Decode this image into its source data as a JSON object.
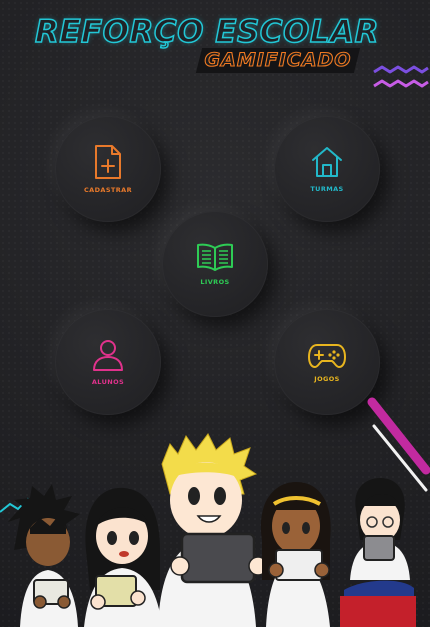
{
  "header": {
    "title": "REFORÇO ESCOLAR",
    "subtitle": "GAMIFICADO"
  },
  "colors": {
    "title_outline": "#22c7d6",
    "subtitle_outline": "#f07a22",
    "cadastrar": "#e8792b",
    "turmas": "#22b8c9",
    "livros": "#2ecc55",
    "alunos": "#e0328c",
    "jogos": "#e8b51f",
    "background": "#232326"
  },
  "menu": {
    "cadastrar": {
      "label": "CADASTRAR",
      "icon": "file-plus-icon"
    },
    "turmas": {
      "label": "TURMAS",
      "icon": "home-icon"
    },
    "livros": {
      "label": "LIVROS",
      "icon": "open-book-icon"
    },
    "alunos": {
      "label": "ALUNOS",
      "icon": "user-icon"
    },
    "jogos": {
      "label": "JOGOS",
      "icon": "gamepad-icon"
    }
  },
  "illustration": {
    "description_icon": "students-with-tablets-illustration"
  }
}
